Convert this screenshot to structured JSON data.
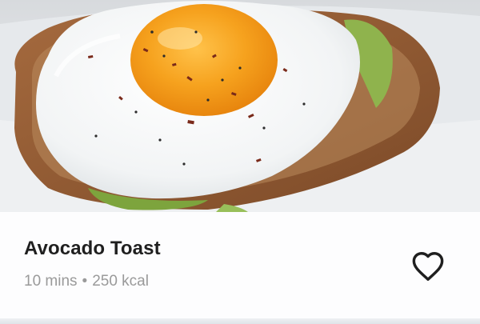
{
  "recipe": {
    "title": "Avocado Toast",
    "time": "10 mins",
    "separator": "•",
    "calories": "250 kcal",
    "favorited": false
  },
  "icons": {
    "photo": "avocado-toast-photo",
    "favorite": "heart-outline-icon"
  },
  "colors": {
    "title": "#1f1f1f",
    "meta": "#9a9a9a",
    "card": "#fdfdfe"
  }
}
